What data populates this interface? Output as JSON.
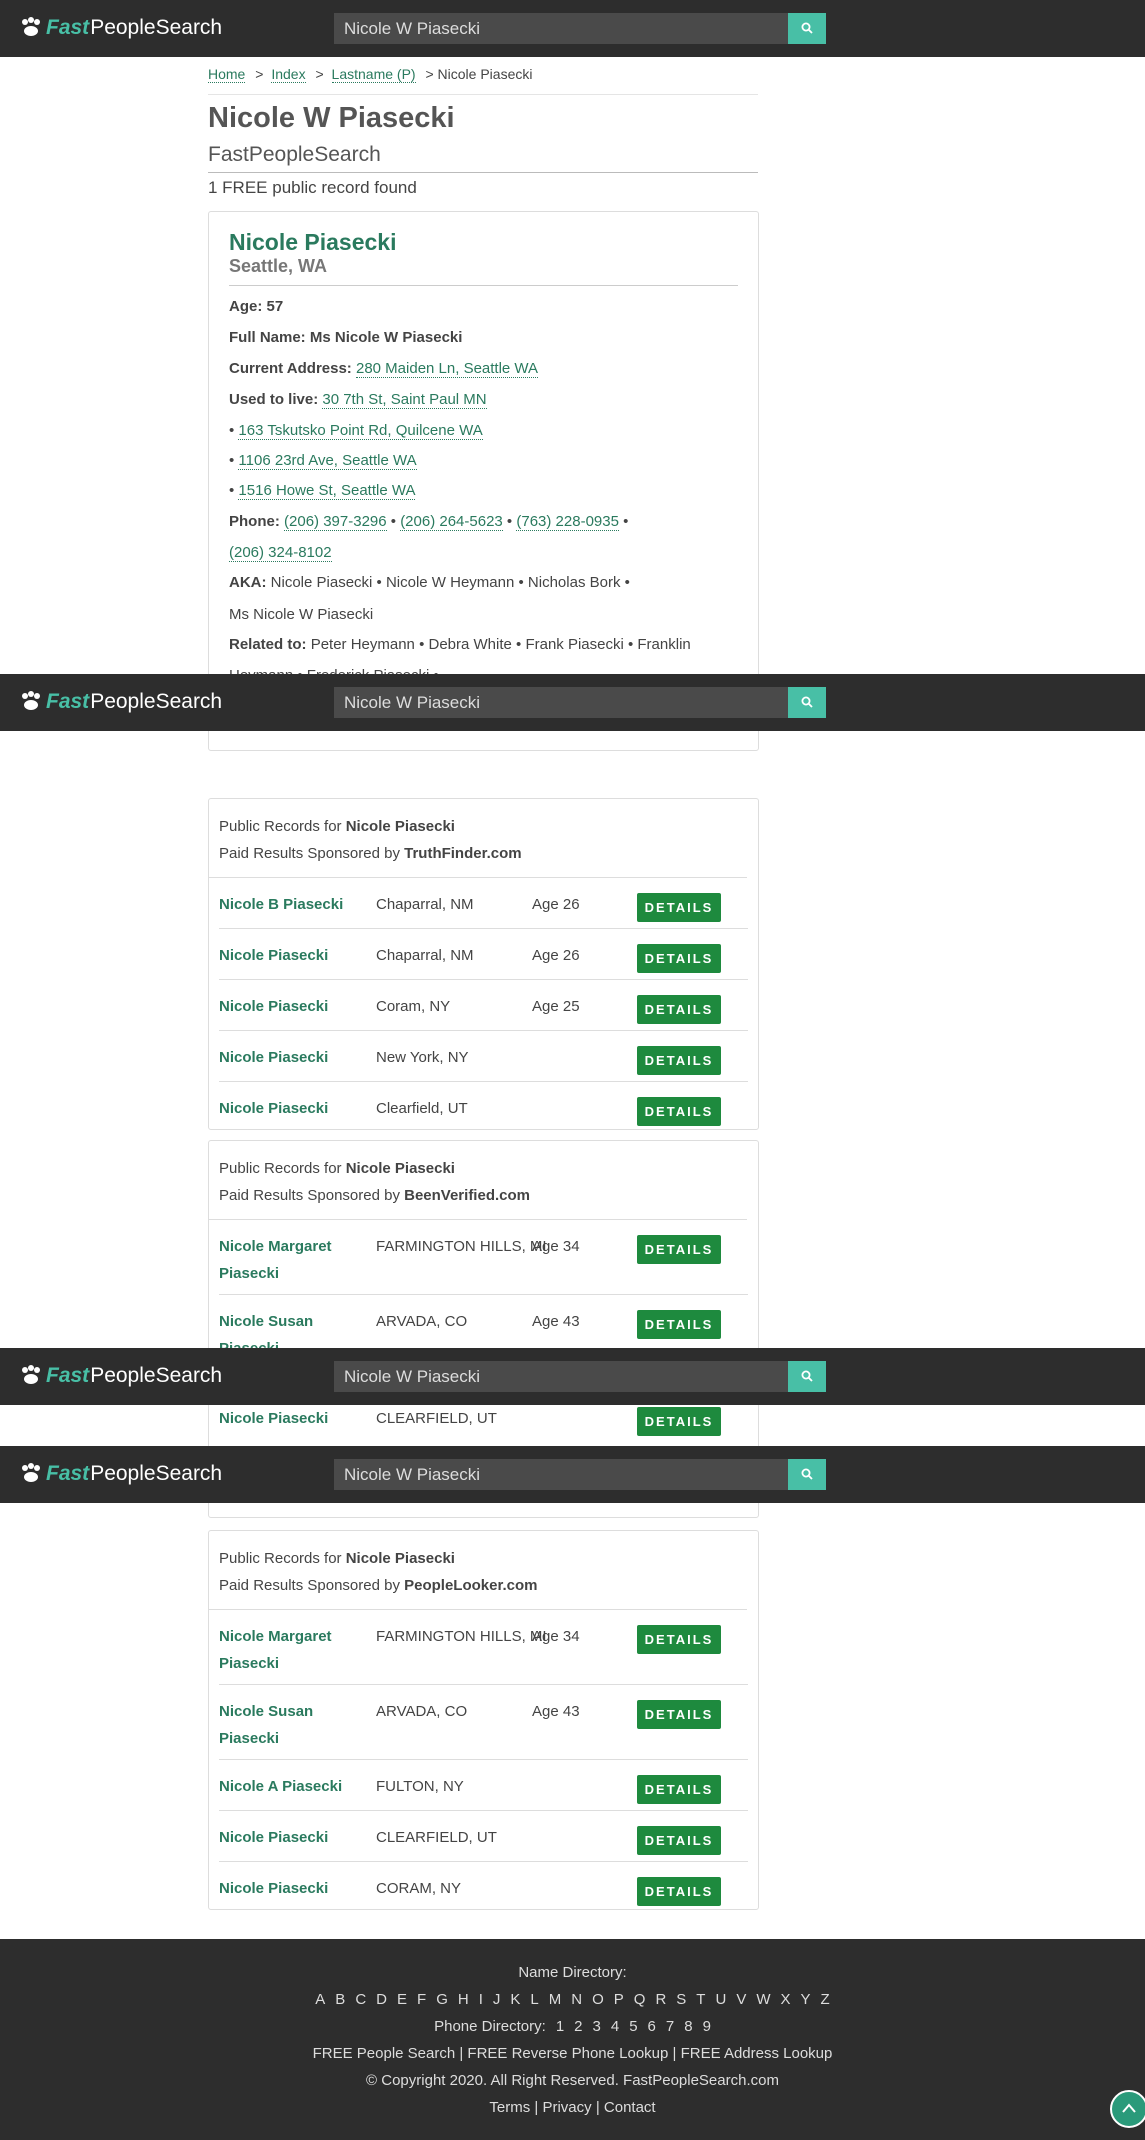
{
  "nav": {
    "logo_fast": "Fast",
    "logo_rest": "PeopleSearch",
    "search_value": "Nicole W Piasecki"
  },
  "breadcrumb": {
    "items": [
      "Home",
      "Index",
      "Lastname (P)"
    ],
    "current": "> Nicole Piasecki"
  },
  "page": {
    "title": "Nicole W Piasecki",
    "subtitle": "FastPeopleSearch",
    "found": "1 FREE public record found"
  },
  "record": {
    "name": "Nicole Piasecki",
    "location": "Seattle, WA",
    "age_label": "Age:",
    "age": "57",
    "fullname_label": "Full Name:",
    "fullname": "Ms Nicole W Piasecki",
    "current_label": "Current Address:",
    "current_address": "280 Maiden Ln, Seattle WA",
    "used_label": "Used to live:",
    "used_address": "30 7th St, Saint Paul MN",
    "past_addresses": [
      "163 Tskutsko Point Rd, Quilcene WA",
      "1106 23rd Ave, Seattle WA",
      "1516 Howe St, Seattle WA"
    ],
    "phone_label": "Phone:",
    "phones": [
      "(206) 397-3296",
      "(206) 264-5623",
      "(763) 228-0935",
      "(206) 324-8102"
    ],
    "aka_label": "AKA:",
    "aka_line1": "Nicole Piasecki • Nicole W Heymann • Nicholas Bork •",
    "aka_line2": "Ms Nicole W Piasecki",
    "related_label": "Related to:",
    "related_line1": "Peter Heymann • Debra White • Frank Piasecki • Franklin",
    "related_line2": "Heymann • Frederick Piasecki •"
  },
  "sponsored": [
    {
      "prefix": "Public Records for ",
      "name": "Nicole Piasecki",
      "sponsor_prefix": "Paid Results Sponsored by ",
      "sponsor": "TruthFinder.com",
      "rows": [
        {
          "name": "Nicole B Piasecki",
          "city": "Chaparral, NM",
          "age": "Age 26"
        },
        {
          "name": "Nicole Piasecki",
          "city": "Chaparral, NM",
          "age": "Age 26"
        },
        {
          "name": "Nicole Piasecki",
          "city": "Coram, NY",
          "age": "Age 25"
        },
        {
          "name": "Nicole Piasecki",
          "city": "New York, NY",
          "age": ""
        },
        {
          "name": "Nicole Piasecki",
          "city": "Clearfield, UT",
          "age": ""
        }
      ]
    },
    {
      "prefix": "Public Records for ",
      "name": "Nicole Piasecki",
      "sponsor_prefix": "Paid Results Sponsored by ",
      "sponsor": "BeenVerified.com",
      "rows": [
        {
          "name": "Nicole Margaret Piasecki",
          "city": "FARMINGTON HILLS, MI",
          "age": "Age 34"
        },
        {
          "name": "Nicole Susan Piasecki",
          "city": "ARVADA, CO",
          "age": "Age 43"
        },
        {
          "name": "Nicole Piasecki",
          "city": "CLEARFIELD, UT",
          "age": ""
        }
      ]
    },
    {
      "prefix": "Public Records for ",
      "name": "Nicole Piasecki",
      "sponsor_prefix": "Paid Results Sponsored by ",
      "sponsor": "PeopleLooker.com",
      "rows": [
        {
          "name": "Nicole Margaret Piasecki",
          "city": "FARMINGTON HILLS, MI",
          "age": "Age 34"
        },
        {
          "name": "Nicole Susan Piasecki",
          "city": "ARVADA, CO",
          "age": "Age 43"
        },
        {
          "name": "Nicole A Piasecki",
          "city": "FULTON, NY",
          "age": ""
        },
        {
          "name": "Nicole Piasecki",
          "city": "CLEARFIELD, UT",
          "age": ""
        },
        {
          "name": "Nicole Piasecki",
          "city": "CORAM, NY",
          "age": ""
        }
      ]
    }
  ],
  "details_label": "DETAILS",
  "footer": {
    "name_directory": "Name Directory:",
    "letters": [
      "A",
      "B",
      "C",
      "D",
      "E",
      "F",
      "G",
      "H",
      "I",
      "J",
      "K",
      "L",
      "M",
      "N",
      "O",
      "P",
      "Q",
      "R",
      "S",
      "T",
      "U",
      "V",
      "W",
      "X",
      "Y",
      "Z"
    ],
    "phone_directory": "Phone Directory:",
    "digits": [
      "1",
      "2",
      "3",
      "4",
      "5",
      "6",
      "7",
      "8",
      "9"
    ],
    "free_links": [
      "FREE People Search",
      "FREE Reverse Phone Lookup",
      "FREE Address Lookup"
    ],
    "copyright": "© Copyright 2020. All Right Reserved. FastPeopleSearch.com",
    "bottom_links": [
      "Terms",
      "Privacy",
      "Contact"
    ]
  },
  "colors": {
    "brand": "#48bfa6",
    "link": "#2a7a5e",
    "button": "#1e8a3e",
    "navbar": "#2d2d2d"
  }
}
